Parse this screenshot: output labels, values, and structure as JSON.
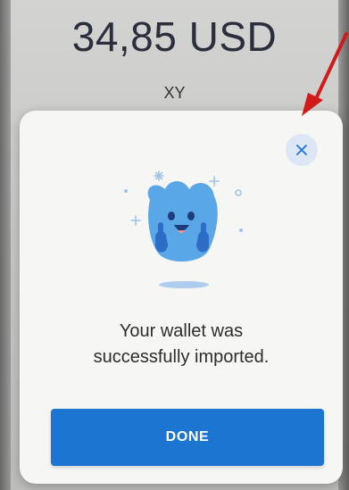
{
  "background": {
    "balance": "34,85 USD",
    "account_name": "XY"
  },
  "dialog": {
    "message_line1": "Your wallet was",
    "message_line2": "successfully imported.",
    "done_label": "DONE",
    "close_icon": "close-icon",
    "illustration": "happy-ghost-thumbs-up"
  },
  "colors": {
    "primary": "#1b75d1",
    "close_bg": "#dce6f5",
    "annotation_arrow": "#d11a1a",
    "mascot": "#5aa7e8"
  }
}
